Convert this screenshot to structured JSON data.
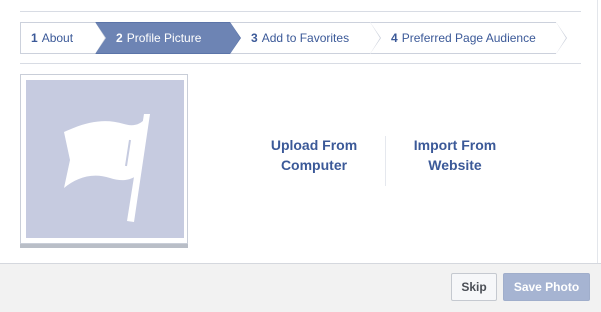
{
  "steps": [
    {
      "num": "1",
      "label": "About"
    },
    {
      "num": "2",
      "label": "Profile Picture"
    },
    {
      "num": "3",
      "label": "Add to Favorites"
    },
    {
      "num": "4",
      "label": "Preferred Page Audience"
    }
  ],
  "active_step": 2,
  "picture": {
    "icon": "flag-icon",
    "placeholder_color": "#c6cbe0"
  },
  "upload": {
    "from_computer": "Upload From Computer",
    "from_website": "Import From Website"
  },
  "footer": {
    "skip_label": "Skip",
    "save_label": "Save Photo"
  },
  "colors": {
    "accent": "#3b5998",
    "active_step": "#6d84b4",
    "save_disabled": "#a6b4d2"
  }
}
